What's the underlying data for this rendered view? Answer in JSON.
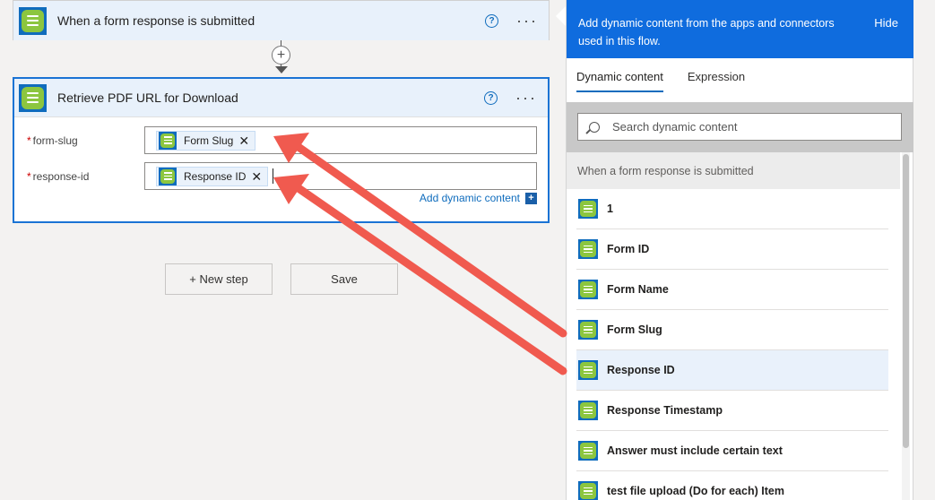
{
  "trigger": {
    "title": "When a form response is submitted"
  },
  "action": {
    "title": "Retrieve PDF URL for Download",
    "fields": [
      {
        "label": "form-slug",
        "token": "Form Slug"
      },
      {
        "label": "response-id",
        "token": "Response ID"
      }
    ],
    "add_dynamic_label": "Add dynamic content"
  },
  "buttons": {
    "new_step": "+ New step",
    "save": "Save"
  },
  "panel": {
    "description": "Add dynamic content from the apps and connectors used in this flow.",
    "hide_label": "Hide",
    "tabs": [
      "Dynamic content",
      "Expression"
    ],
    "active_tab": "Dynamic content",
    "search_placeholder": "Search dynamic content",
    "section_title": "When a form response is submitted",
    "items": [
      {
        "label": "1"
      },
      {
        "label": "Form ID"
      },
      {
        "label": "Form Name"
      },
      {
        "label": "Form Slug"
      },
      {
        "label": "Response ID",
        "selected": true
      },
      {
        "label": "Response Timestamp"
      },
      {
        "label": "Answer must include certain text"
      },
      {
        "label": "test file upload (Do for each) Item"
      }
    ]
  },
  "colors": {
    "accent_blue": "#0f6cde",
    "connector_green": "#8cc63f",
    "annotation_red": "#f05a4f"
  },
  "icons": [
    "forms-connector-icon",
    "help-icon",
    "more-icon",
    "add-step-icon",
    "search-icon",
    "close-icon",
    "add-icon"
  ]
}
